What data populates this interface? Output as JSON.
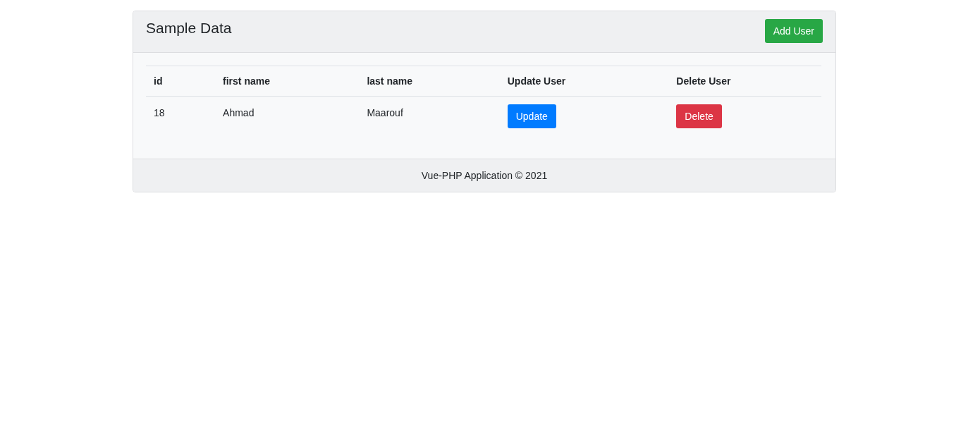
{
  "card": {
    "title": "Sample Data",
    "add_button": "Add User"
  },
  "table": {
    "columns": [
      "id",
      "first name",
      "last name",
      "Update User",
      "Delete User"
    ],
    "rows": [
      {
        "id": "18",
        "first_name": "Ahmad",
        "last_name": "Maarouf",
        "update_button": "Update",
        "delete_button": "Delete"
      }
    ]
  },
  "footer": "Vue-PHP Application © 2021"
}
